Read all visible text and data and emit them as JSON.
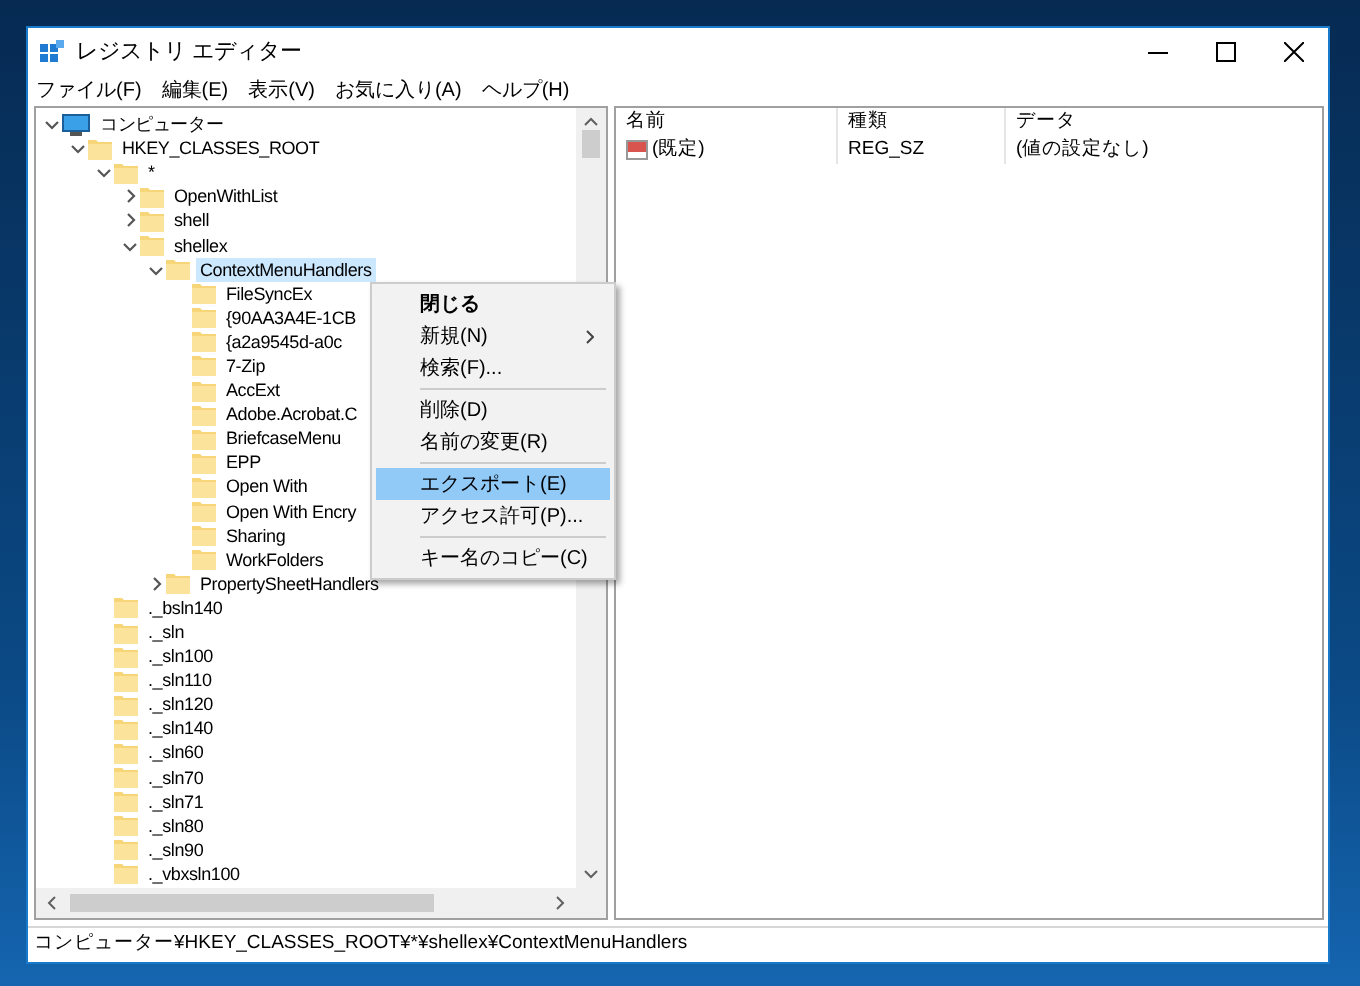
{
  "window": {
    "title": "レジストリ エディター"
  },
  "menu": [
    "ファイル(F)",
    "編集(E)",
    "表示(V)",
    "お気に入り(A)",
    "ヘルプ(H)"
  ],
  "tree": [
    {
      "label": "コンピューター",
      "kind": "computer",
      "expanded": true,
      "selected": false,
      "children": [
        {
          "label": "HKEY_CLASSES_ROOT",
          "kind": "folder",
          "expanded": true,
          "selected": false,
          "children": [
            {
              "label": "*",
              "kind": "folder",
              "expanded": true,
              "selected": false,
              "children": [
                {
                  "label": "OpenWithList",
                  "kind": "folder",
                  "expanded": false,
                  "selected": false
                },
                {
                  "label": "shell",
                  "kind": "folder",
                  "expanded": false,
                  "selected": false
                },
                {
                  "label": "shellex",
                  "kind": "folder",
                  "expanded": true,
                  "selected": false,
                  "children": [
                    {
                      "label": "ContextMenuHandlers",
                      "kind": "folder",
                      "expanded": true,
                      "selected": true,
                      "children": [
                        {
                          "label": "FileSyncEx",
                          "kind": "folder",
                          "selected": false
                        },
                        {
                          "label": "{90AA3A4E-1CB",
                          "kind": "folder",
                          "selected": false
                        },
                        {
                          "label": "{a2a9545d-a0c",
                          "kind": "folder",
                          "selected": false
                        },
                        {
                          "label": "7-Zip",
                          "kind": "folder",
                          "selected": false
                        },
                        {
                          "label": "AccExt",
                          "kind": "folder",
                          "selected": false
                        },
                        {
                          "label": "Adobe.Acrobat.C",
                          "kind": "folder",
                          "selected": false
                        },
                        {
                          "label": "BriefcaseMenu",
                          "kind": "folder",
                          "selected": false
                        },
                        {
                          "label": "EPP",
                          "kind": "folder",
                          "selected": false
                        },
                        {
                          "label": "Open With",
                          "kind": "folder",
                          "selected": false
                        },
                        {
                          "label": "Open With Encry",
                          "kind": "folder",
                          "selected": false
                        },
                        {
                          "label": "Sharing",
                          "kind": "folder",
                          "selected": false
                        },
                        {
                          "label": "WorkFolders",
                          "kind": "folder",
                          "selected": false
                        }
                      ]
                    },
                    {
                      "label": "PropertySheetHandlers",
                      "kind": "folder",
                      "expanded": false,
                      "selected": false
                    }
                  ]
                }
              ]
            },
            {
              "label": "._bsln140",
              "kind": "folder",
              "selected": false
            },
            {
              "label": "._sln",
              "kind": "folder",
              "selected": false
            },
            {
              "label": "._sln100",
              "kind": "folder",
              "selected": false
            },
            {
              "label": "._sln110",
              "kind": "folder",
              "selected": false
            },
            {
              "label": "._sln120",
              "kind": "folder",
              "selected": false
            },
            {
              "label": "._sln140",
              "kind": "folder",
              "selected": false
            },
            {
              "label": "._sln60",
              "kind": "folder",
              "selected": false
            },
            {
              "label": "._sln70",
              "kind": "folder",
              "selected": false
            },
            {
              "label": "._sln71",
              "kind": "folder",
              "selected": false
            },
            {
              "label": "._sln80",
              "kind": "folder",
              "selected": false
            },
            {
              "label": "._sln90",
              "kind": "folder",
              "selected": false
            },
            {
              "label": "._vbxsln100",
              "kind": "folder",
              "selected": false
            }
          ]
        }
      ]
    }
  ],
  "values": {
    "columns": [
      "名前",
      "種類",
      "データ"
    ],
    "rows": [
      {
        "name": "(既定)",
        "type": "REG_SZ",
        "data": "(値の設定なし)"
      }
    ]
  },
  "context_menu": [
    {
      "kind": "item",
      "label": "閉じる",
      "default": true,
      "submenu": false,
      "selected": false
    },
    {
      "kind": "item",
      "label": "新規(N)",
      "default": false,
      "submenu": true,
      "selected": false
    },
    {
      "kind": "item",
      "label": "検索(F)...",
      "default": false,
      "submenu": false,
      "selected": false
    },
    {
      "kind": "separator"
    },
    {
      "kind": "item",
      "label": "削除(D)",
      "default": false,
      "submenu": false,
      "selected": false
    },
    {
      "kind": "item",
      "label": "名前の変更(R)",
      "default": false,
      "submenu": false,
      "selected": false
    },
    {
      "kind": "separator"
    },
    {
      "kind": "item",
      "label": "エクスポート(E)",
      "default": false,
      "submenu": false,
      "selected": true
    },
    {
      "kind": "item",
      "label": "アクセス許可(P)...",
      "default": false,
      "submenu": false,
      "selected": false
    },
    {
      "kind": "separator"
    },
    {
      "kind": "item",
      "label": "キー名のコピー(C)",
      "default": false,
      "submenu": false,
      "selected": false
    }
  ],
  "status_bar": "コンピューター¥HKEY_CLASSES_ROOT¥*¥shellex¥ContextMenuHandlers"
}
